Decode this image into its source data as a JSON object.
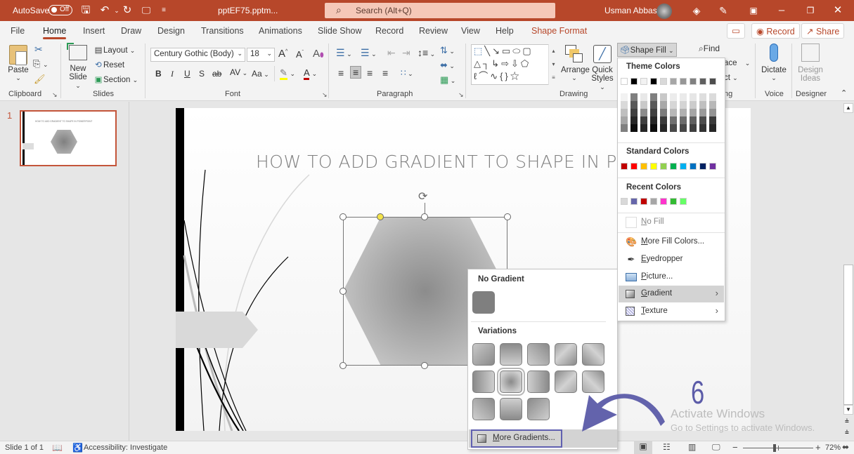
{
  "titlebar": {
    "autosave_label": "AutoSave",
    "autosave_state": "Off",
    "filename": "pptEF75.pptm...",
    "search_placeholder": "Search (Alt+Q)",
    "user_name": "Usman Abbasi",
    "icons": [
      "save-icon",
      "undo-icon",
      "redo-icon",
      "present-icon",
      "customize-icon",
      "diamond-icon",
      "pen-icon",
      "ribbon-display-icon",
      "minimize-icon",
      "restore-icon",
      "close-icon"
    ]
  },
  "tabs": [
    {
      "label": "File"
    },
    {
      "label": "Home",
      "active": true
    },
    {
      "label": "Insert"
    },
    {
      "label": "Draw"
    },
    {
      "label": "Design"
    },
    {
      "label": "Transitions"
    },
    {
      "label": "Animations"
    },
    {
      "label": "Slide Show"
    },
    {
      "label": "Record"
    },
    {
      "label": "Review"
    },
    {
      "label": "View"
    },
    {
      "label": "Help"
    },
    {
      "label": "Shape Format",
      "contextual": true
    }
  ],
  "tabs_right": {
    "record_label": "Record",
    "share_label": "Share"
  },
  "ribbon": {
    "clipboard": {
      "group": "Clipboard",
      "paste": "Paste"
    },
    "slides": {
      "group": "Slides",
      "new_slide": "New",
      "new_slide2": "Slide",
      "layout": "Layout",
      "reset": "Reset",
      "section": "Section"
    },
    "font": {
      "group": "Font",
      "font_name": "Century Gothic (Body)",
      "font_size": "18",
      "bold": "B",
      "italic": "I",
      "underline": "U",
      "shadow": "S",
      "strike": "ab",
      "spacing": "AV",
      "case": "Aa"
    },
    "paragraph": {
      "group": "Paragraph"
    },
    "drawing": {
      "group": "Drawing",
      "arrange": "Arrange",
      "quick_styles1": "Quick",
      "quick_styles2": "Styles",
      "shape_fill": "Shape Fill"
    },
    "editing": {
      "find": "Find",
      "replace_partial": "ace",
      "select_partial": "ct",
      "group_partial": "ng"
    },
    "voice": {
      "group": "Voice",
      "dictate": "Dictate"
    },
    "designer": {
      "group": "Designer",
      "design_ideas1": "Design",
      "design_ideas2": "Ideas"
    }
  },
  "thumbnails": [
    {
      "number": "1",
      "title": "HOW TO ADD GRADIENT TO SHAPE IN POWERPOINT"
    }
  ],
  "slide": {
    "title": "HOW TO ADD GRADIENT TO SHAPE IN POWER"
  },
  "shape_fill_menu": {
    "theme_colors_label": "Theme Colors",
    "theme_top": [
      "#ffffff",
      "#000000",
      "#f2f2f2",
      "#000000",
      "#d9d9d9",
      "#a6a6a6",
      "#969696",
      "#808080",
      "#5f5f5f",
      "#4d4d4d"
    ],
    "theme_shades": [
      [
        "#f2f2f2",
        "#d9d9d9",
        "#bfbfbf",
        "#a6a6a6",
        "#808080"
      ],
      [
        "#7f7f7f",
        "#595959",
        "#404040",
        "#262626",
        "#0d0d0d"
      ],
      [
        "#e8e8e8",
        "#c9c9c9",
        "#8c8c8c",
        "#3f3f3f",
        "#262626"
      ],
      [
        "#7f7f7f",
        "#595959",
        "#404040",
        "#262626",
        "#0d0d0d"
      ],
      [
        "#c8c8c8",
        "#a8a8a8",
        "#7c7c7c",
        "#3a3a3a",
        "#262626"
      ],
      [
        "#ececec",
        "#d6d6d6",
        "#b8b8b8",
        "#707070",
        "#4a4a4a"
      ],
      [
        "#eaeaea",
        "#d4d4d4",
        "#b0b0b0",
        "#6c6c6c",
        "#484848"
      ],
      [
        "#e6e6e6",
        "#cccccc",
        "#a6a6a6",
        "#606060",
        "#404040"
      ],
      [
        "#dedede",
        "#c0c0c0",
        "#9a9a9a",
        "#4c4c4c",
        "#333333"
      ],
      [
        "#dbdbdb",
        "#b8b8b8",
        "#949494",
        "#3b3b3b",
        "#262626"
      ]
    ],
    "standard_colors_label": "Standard Colors",
    "standard_colors": [
      "#c00000",
      "#ff0000",
      "#ffc000",
      "#ffff00",
      "#92d050",
      "#00b050",
      "#00b0f0",
      "#0070c0",
      "#002060",
      "#7030a0"
    ],
    "recent_colors_label": "Recent Colors",
    "recent_colors": [
      "#d9d9d9",
      "#6666aa",
      "#c00000",
      "#a6a6a6",
      "#ff33cc",
      "#33bb33",
      "#66ff66"
    ],
    "items": [
      {
        "label": "No Fill",
        "icon": "no-fill-icon",
        "disabled": true
      },
      {
        "label": "More Fill Colors...",
        "icon": "palette-icon"
      },
      {
        "label": "Eyedropper",
        "icon": "eyedropper-icon"
      },
      {
        "label": "Picture...",
        "icon": "picture-icon"
      },
      {
        "label": "Gradient",
        "icon": "gradient-icon",
        "submenu": true,
        "highlighted": true
      },
      {
        "label": "Texture",
        "icon": "texture-icon",
        "submenu": true
      }
    ]
  },
  "gradient_menu": {
    "no_gradient_label": "No Gradient",
    "variations_label": "Variations",
    "variations_count": 13,
    "selected_variation": 7,
    "more_gradients_label": "More Gradients..."
  },
  "annotation": {
    "step_number": "6",
    "arrow_color": "#5b5ba8"
  },
  "watermark": {
    "line1": "Activate Windows",
    "line2": "Go to Settings to activate Windows."
  },
  "status": {
    "slide_info": "Slide 1 of 1",
    "accessibility": "Accessibility: Investigate",
    "zoom": "72%",
    "zoom_fraction": 0.45
  }
}
